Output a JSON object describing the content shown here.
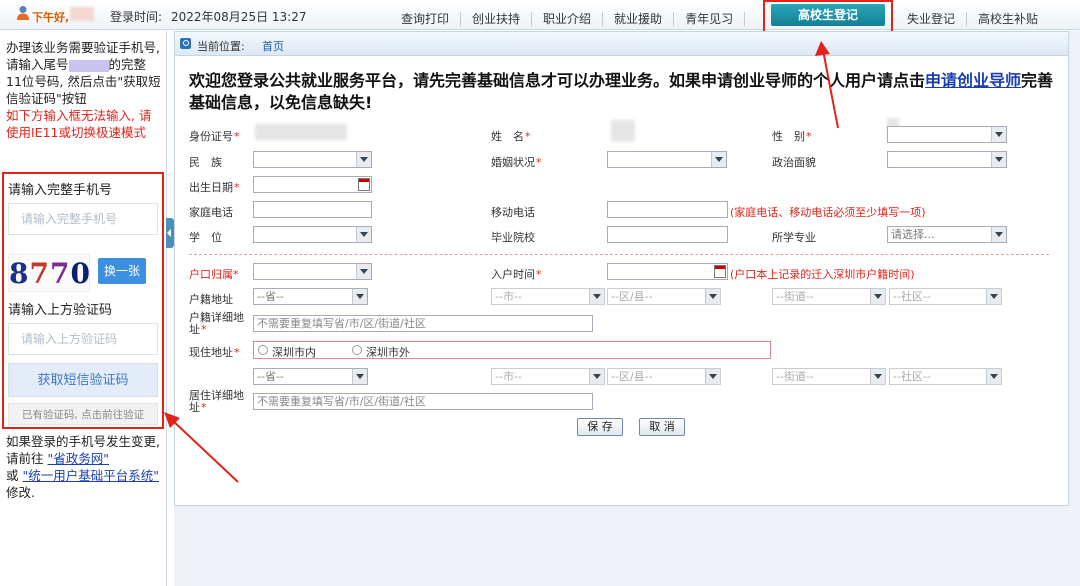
{
  "header": {
    "greeting": "下午好,",
    "login_label": "登录时间:",
    "login_time": "2022年08月25日 13:27",
    "nav": [
      "查询打印",
      "创业扶持",
      "职业介绍",
      "就业援助",
      "青年见习"
    ],
    "nav_active": "高校生登记",
    "nav_right": [
      "失业登记",
      "高校生补贴"
    ]
  },
  "sidebar": {
    "intro_1": "办理该业务需要验证手机号, 请输入尾号",
    "intro_2": "的完整11位号码, 然后点击\"获取短信验证码\"按钮",
    "warn": "如下方输入框无法输入, 请使用IE11或切换极速模式",
    "phone_label": "请输入完整手机号",
    "phone_placeholder": "请输入完整手机号",
    "captcha_chars": [
      "8",
      "7",
      "7",
      "0"
    ],
    "refresh_label": "换一张",
    "captcha_label": "请输入上方验证码",
    "captcha_placeholder": "请输入上方验证码",
    "sms_button": "获取短信验证码",
    "has_code_button": "已有验证码, 点击前往验证",
    "foot_1": "如果登录的手机号发生变更, 请前往",
    "foot_link_1": "\"省政务网\"",
    "foot_or": "或",
    "foot_link_2": "\"统一用户基础平台系统\"",
    "foot_2": "修改."
  },
  "breadcrumb": {
    "label": "当前位置:",
    "current": "首页"
  },
  "welcome": {
    "text_before": "欢迎您登录公共就业服务平台，请先完善基础信息才可以办理业务。如果申请创业导师的个人用户请点击",
    "link": "申请创业导师",
    "text_after": "完善基础信息，以免信息缺失!"
  },
  "form": {
    "id_card": "身份证号",
    "name": "姓　名",
    "gender": "性　别",
    "ethnicity": "民　族",
    "marital": "婚姻状况",
    "political": "政治面貌",
    "birth": "出生日期",
    "home_phone": "家庭电话",
    "mobile": "移动电话",
    "phone_hint": "(家庭电话、移动电话必须至少填写一项)",
    "degree": "学　位",
    "school": "毕业院校",
    "major": "所学专业",
    "major_placeholder": "请选择...",
    "hukou": "户口归属",
    "move_in": "入户时间",
    "move_in_hint": "(户口本上记录的迁入深圳市户籍时间)",
    "hukou_addr": "户籍地址",
    "province_ph": "--省--",
    "city_ph": "--市--",
    "district_ph": "--区/县--",
    "street_ph": "--街道--",
    "community_ph": "--社区--",
    "hukou_detail": "户籍详细地址",
    "detail_placeholder": "不需要重复填写省/市/区/街道/社区",
    "current_addr": "现住地址",
    "in_sz": "深圳市内",
    "out_sz": "深圳市外",
    "live_detail": "居住详细地址",
    "save": "保 存",
    "cancel": "取 消"
  },
  "colors": {
    "accent_red": "#e2231a",
    "active_tab": "#137f95",
    "link": "#1a3fb0",
    "sms_button_bg": "#e3ecf8"
  }
}
